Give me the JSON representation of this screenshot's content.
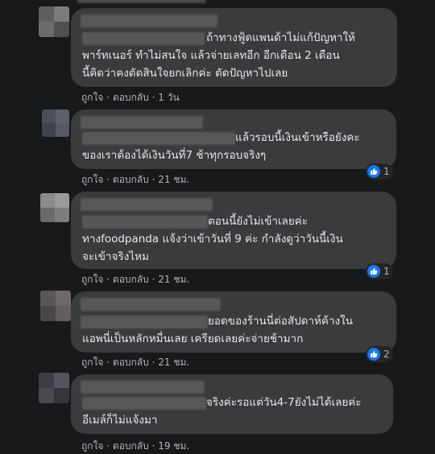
{
  "comments": [
    {
      "text_lines": [
        "ถ้าทางฟู้ดแพนด้าไม่แก้ปัญหาให้",
        "พาร์ทเนอร์ ทำไม่สนใจ แล้วจ่ายเลทอีก อีกเดือน 2 เดือน",
        "นี้คิดว่าคงตัดสินใจยกเลิกค่ะ ตัดปัญหาไปเลย"
      ],
      "like": "ถูกใจ",
      "reply": "ตอบกลับ",
      "time": "1 วัน",
      "reactions": ""
    },
    {
      "text_lines": [
        "แล้วรอบนี้เงินเข้าหรือยังคะ",
        "ของเราต้องได้เงินวันที่7 ช้าทุกรอบจริงๆ"
      ],
      "like": "ถูกใจ",
      "reply": "ตอบกลับ",
      "time": "21 ชม.",
      "reactions": "1"
    },
    {
      "text_lines": [
        "ตอนนี้ยังไม่เข้าเลยค่ะ",
        "ทางfoodpanda แจ้งว่าเข้าวันที่ 9 ค่ะ กำลังดูว่าวันนี้เงิน",
        "จะเข้าจริงไหม"
      ],
      "like": "ถูกใจ",
      "reply": "ตอบกลับ",
      "time": "21 ชม.",
      "reactions": "1"
    },
    {
      "text_lines": [
        "ยอดของร้านนี่ต่อสัปดาห์ค้างใน",
        "แอพนี่เป็นหลักหมื่นเลย เครียดเลยค่ะจ่ายช้ามาก"
      ],
      "like": "ถูกใจ",
      "reply": "ตอบกลับ",
      "time": "21 ชม.",
      "reactions": "2"
    },
    {
      "text_lines": [
        "จริงค่ะรอแต่วัน4-7ยังไม่ได้เลยค่ะ",
        "อีเมล์ก็ไม่แจ้งมา"
      ],
      "like": "ถูกใจ",
      "reply": "ตอบกลับ",
      "time": "19 ชม.",
      "reactions": ""
    }
  ],
  "separator": "·",
  "colors": {
    "background": "#18191a",
    "bubble": "#3a3b3c",
    "text": "#e4e6eb",
    "muted": "#b0b3b8",
    "like_blue": "#1877f2"
  }
}
